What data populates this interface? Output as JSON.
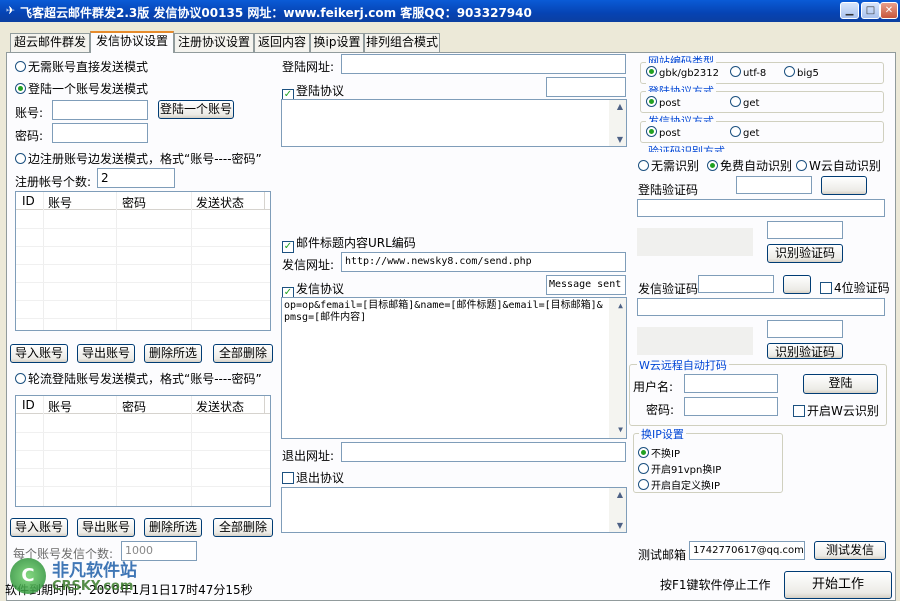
{
  "window": {
    "title": "飞客超云邮件群发2.3版  发信协议00135  网址：www.feikerj.com  客服QQ：903327940"
  },
  "tabs": [
    "超云邮件群发",
    "发信协议设置",
    "注册协议设置",
    "返回内容",
    "换ip设置",
    "排列组合模式"
  ],
  "left": {
    "mode_no_account": "无需账号直接发送模式",
    "mode_login_one": "登陆一个账号发送模式",
    "account_label": "账号:",
    "password_label": "密码:",
    "login_button": "登陆一个账号",
    "mode_register": "边注册账号边发送模式，格式“账号----密码”",
    "register_count_label": "注册帐号个数:",
    "register_count_value": "2",
    "columns": [
      "ID",
      "账号",
      "密码",
      "发送状态"
    ],
    "buttons": [
      "导入账号",
      "导出账号",
      "删除所选",
      "全部删除"
    ],
    "mode_rotate": "轮流登陆账号发送模式，格式“账号----密码”",
    "per_account_label": "每个账号发信个数:",
    "per_account_value": "1000",
    "status_text": "软件到期时间：2020年1月1日17时47分15秒"
  },
  "middle": {
    "login_url_label": "登陆网址:",
    "login_protocol_label": "登陆协议",
    "subject_urlencode_label": "邮件标题内容URL编码",
    "send_url_label": "发信网址:",
    "send_url_value": "http://www.newsky8.com/send.php",
    "send_protocol_label": "发信协议",
    "send_status_value": "Message sent",
    "send_protocol_body": "op=op&femail=[目标邮箱]&name=[邮件标题]&email=[目标邮箱]&pmsg=[邮件内容]",
    "logout_url_label": "退出网址:",
    "logout_protocol_label": "退出协议"
  },
  "right": {
    "encoding_group": "网站编码类型",
    "encodings": [
      "gbk/gb2312",
      "utf-8",
      "big5"
    ],
    "login_method_group": "登陆协议方式",
    "send_method_group": "发信协议方式",
    "methods": [
      "post",
      "get"
    ],
    "captcha_group": "验证码识别方式",
    "captcha_modes": [
      "无需识别",
      "免费自动识别",
      "W云自动识别"
    ],
    "login_captcha_label": "登陆验证码",
    "recognize_button": "识别验证码",
    "send_captcha_label": "发信验证码",
    "four_digit_label": "4位验证码",
    "remote_group": "W云远程自动打码",
    "username_label": "用户名:",
    "password_label": "密码:",
    "login_button": "登陆",
    "enable_wcloud_label": "开启W云识别",
    "ip_group": "换IP设置",
    "ip_modes": [
      "不换IP",
      "开启91vpn换IP",
      "开启自定义换IP"
    ],
    "test_email_label": "测试邮箱",
    "test_email_value": "1742770617@qq.com",
    "test_send_button": "测试发信",
    "hint": "按F1键软件停止工作",
    "start_button": "开始工作"
  },
  "watermark": {
    "cn": "非凡软件站",
    "en": "CRSKY.com"
  },
  "colors": {
    "titlebar": "#0643b3",
    "tab_accent": "#e68b2c",
    "group_title": "#0046d5"
  }
}
